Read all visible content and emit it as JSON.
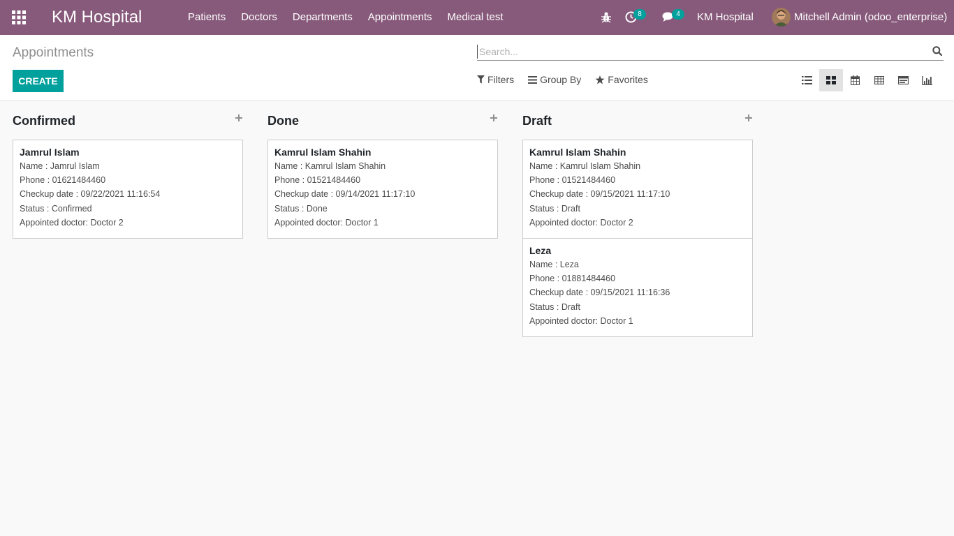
{
  "navbar": {
    "brand": "KM Hospital",
    "menu": [
      "Patients",
      "Doctors",
      "Departments",
      "Appointments",
      "Medical test"
    ],
    "activity_count": "8",
    "message_count": "4",
    "company": "KM Hospital",
    "user": "Mitchell Admin (odoo_enterprise)",
    "color": "#875a7b"
  },
  "control_panel": {
    "breadcrumb": "Appointments",
    "create_label": "CREATE",
    "search_placeholder": "Search...",
    "filters_label": "Filters",
    "group_by_label": "Group By",
    "favorites_label": "Favorites",
    "active_view": "kanban",
    "accent_color": "#00a09d"
  },
  "columns": [
    {
      "title": "Confirmed",
      "cards": [
        {
          "title": "Jamrul Islam",
          "name": "Name : Jamrul Islam",
          "phone": "Phone : 01621484460",
          "checkup": "Checkup date : 09/22/2021 11:16:54",
          "status": "Status : Confirmed",
          "doctor": "Appointed doctor: Doctor 2"
        }
      ]
    },
    {
      "title": "Done",
      "cards": [
        {
          "title": "Kamrul Islam Shahin",
          "name": "Name : Kamrul Islam Shahin",
          "phone": "Phone : 01521484460",
          "checkup": "Checkup date : 09/14/2021 11:17:10",
          "status": "Status : Done",
          "doctor": "Appointed doctor: Doctor 1"
        }
      ]
    },
    {
      "title": "Draft",
      "cards": [
        {
          "title": "Kamrul Islam Shahin",
          "name": "Name : Kamrul Islam Shahin",
          "phone": "Phone : 01521484460",
          "checkup": "Checkup date : 09/15/2021 11:17:10",
          "status": "Status : Draft",
          "doctor": "Appointed doctor: Doctor 2"
        },
        {
          "title": "Leza",
          "name": "Name : Leza",
          "phone": "Phone : 01881484460",
          "checkup": "Checkup date : 09/15/2021 11:16:36",
          "status": "Status : Draft",
          "doctor": "Appointed doctor: Doctor 1"
        }
      ]
    }
  ]
}
